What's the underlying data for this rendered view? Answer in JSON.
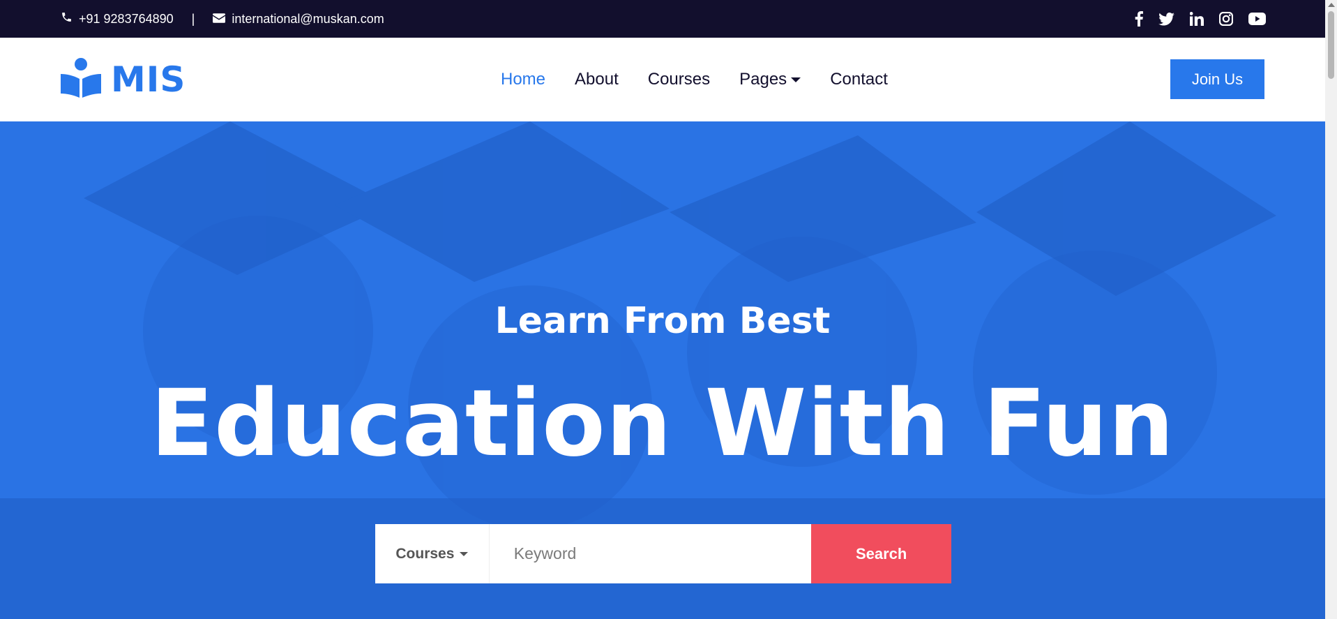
{
  "topbar": {
    "phone": "+91 9283764890",
    "separator": "|",
    "email": "international@muskan.com",
    "social": [
      "facebook-icon",
      "twitter-icon",
      "linkedin-icon",
      "instagram-icon",
      "youtube-icon"
    ]
  },
  "brand": {
    "name": "MIS",
    "color": "#2878eb"
  },
  "nav": {
    "items": [
      {
        "label": "Home",
        "active": true
      },
      {
        "label": "About"
      },
      {
        "label": "Courses"
      },
      {
        "label": "Pages",
        "dropdown": true
      },
      {
        "label": "Contact"
      }
    ],
    "join_label": "Join Us"
  },
  "hero": {
    "subtitle": "Learn From Best",
    "title": "Education With Fun"
  },
  "search": {
    "category": "Courses",
    "placeholder": "Keyword",
    "button": "Search"
  },
  "colors": {
    "dark": "#120f2d",
    "primary": "#2878eb",
    "accent": "#f14d5d"
  }
}
